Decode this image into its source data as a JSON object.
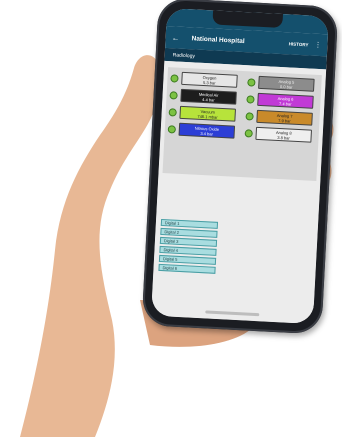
{
  "header": {
    "title": "National Hospital",
    "history_label": "HISTORY",
    "back_icon": "arrow-left-icon",
    "menu_icon": "kebab-menu-icon"
  },
  "subheader": {
    "title": "Radiology"
  },
  "sensors": [
    {
      "name": "Oxygen",
      "value": "5.3 bar",
      "color": "#e6e6e6",
      "text": "#222"
    },
    {
      "name": "Analog 5",
      "value": "0.0 bar",
      "color": "#8c8c8c",
      "text": "#eee"
    },
    {
      "name": "Medical Air",
      "value": "4.4 bar",
      "color": "#1d1d1d",
      "text": "#fff"
    },
    {
      "name": "Analog 6",
      "value": "7.4 bar",
      "color": "#c13ad6",
      "text": "#fff"
    },
    {
      "name": "Vacuum",
      "value": "746.1 mbar",
      "color": "#b7e33b",
      "text": "#222"
    },
    {
      "name": "Analog 7",
      "value": "7.9 bar",
      "color": "#c98a2a",
      "text": "#222"
    },
    {
      "name": "Nitrous Oxide",
      "value": "3.4 bar",
      "color": "#2c3ed6",
      "text": "#fff"
    },
    {
      "name": "Analog 8",
      "value": "3.8 bar",
      "color": "#efefef",
      "text": "#222"
    }
  ],
  "digitals": [
    "Digital 1",
    "Digital 2",
    "Digital 3",
    "Digital 4",
    "Digital 5",
    "Digital 6"
  ],
  "colors": {
    "primary": "#14506d",
    "secondary": "#0f3a52",
    "status_ok": "#7cc243",
    "digital_bg": "#a9dde0"
  }
}
